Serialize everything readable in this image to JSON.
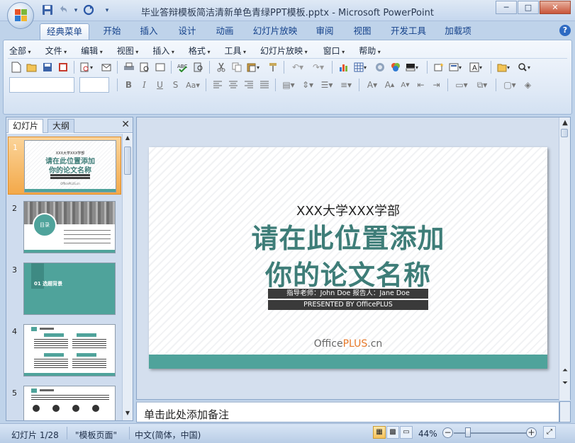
{
  "window": {
    "title": "毕业答辩模板简洁清新单色青绿PPT模板.pptx - Microsoft PowerPoint",
    "controls": {
      "minimize": "─",
      "maximize": "□",
      "close": "✕"
    }
  },
  "qat": {
    "save_icon": "save-icon",
    "undo_icon": "undo-icon",
    "redo_icon": "redo-icon",
    "more": "▾"
  },
  "ribbon_tabs": [
    "经典菜单",
    "开始",
    "插入",
    "设计",
    "动画",
    "幻灯片放映",
    "审阅",
    "视图",
    "开发工具",
    "加载项"
  ],
  "active_tab": 0,
  "help": "?",
  "menu": [
    "全部",
    "文件",
    "编辑",
    "视图",
    "插入",
    "格式",
    "工具",
    "幻灯片放映",
    "窗口",
    "帮助"
  ],
  "font_box": {
    "value": "",
    "size": ""
  },
  "panel": {
    "tabs": [
      "幻灯片",
      "大纲"
    ],
    "close": "✕",
    "slides": [
      "1",
      "2",
      "3",
      "4",
      "5"
    ],
    "thumb1": {
      "line1": "XXX大学XXX学部",
      "line2": "请在此位置添加",
      "line3": "你的论文名称",
      "brand": "OfficePLUS.cn"
    },
    "thumb2": {
      "circle": "目录"
    },
    "thumb3": {
      "label": "01  选题背景"
    }
  },
  "slide": {
    "subtitle": "XXX大学XXX学部",
    "title_line1": "请在此位置添加",
    "title_line2": "你的论文名称",
    "advisor": "指导老师：John Doe  报告人：Jane Doe",
    "presented": "PRESENTED BY OfficePLUS",
    "brand_a": "Office",
    "brand_b": "PLUS",
    "brand_c": ".cn",
    "colors": {
      "teal": "#4fa39b",
      "dark_teal": "#3e7d78",
      "dark_bar": "#3a3a3a",
      "orange": "#e87a2a"
    }
  },
  "notes": {
    "placeholder": "单击此处添加备注"
  },
  "status": {
    "slide": "幻灯片 1/28",
    "theme": "\"模板页面\"",
    "lang": "中文(简体，中国)",
    "zoom": "44%"
  }
}
